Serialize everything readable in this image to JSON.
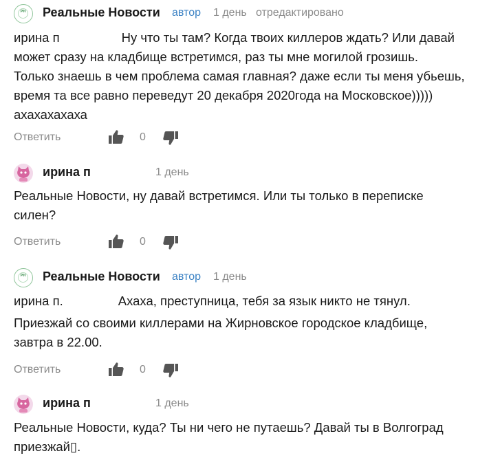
{
  "comments": [
    {
      "author": "Реальные Новости",
      "badge": "автор",
      "time": "1 день",
      "edited": "отредактировано",
      "avatar": "rn-logo-icon",
      "avatar_text": "РН",
      "text_prefix": "ирина п",
      "lines": [
        "Ну что ты там? Когда твоих киллеров ждать? Или давай",
        "может сразу на кладбище встретимся, раз ты мне могилой грозишь.",
        "Только знаешь в чем проблема самая главная? даже если ты меня убьешь,",
        "время та все равно переведут 20 декабря 2020года на Московское)))))",
        "ахахахахаха"
      ],
      "reply_label": "Ответить",
      "likes": "0"
    },
    {
      "author": "ирина п",
      "time": "1 день",
      "avatar": "pink-cat-avatar-icon",
      "lines": [
        "Реальные Новости, ну давай встретимся. Или ты только в переписке",
        "силен?"
      ],
      "reply_label": "Ответить",
      "likes": "0"
    },
    {
      "author": "Реальные Новости",
      "badge": "автор",
      "time": "1 день",
      "avatar": "rn-logo-icon",
      "avatar_text": "РН",
      "text_prefix": "ирина п.",
      "lines": [
        "Ахаха, преступница, тебя за язык никто не тянул.",
        "Приезжай со своими киллерами на Жирновское городское кладбище,",
        "завтра в 22.00."
      ],
      "reply_label": "Ответить",
      "likes": "0"
    },
    {
      "author": "ирина п",
      "time": "1 день",
      "avatar": "pink-cat-avatar-icon",
      "lines": [
        "Реальные Новости, куда? Ты ни чего не путаешь? Давай ты в Волгоград",
        "приезжай▯."
      ]
    }
  ],
  "colors": {
    "badge": "#3b82c4",
    "muted": "#8a8a8a",
    "text": "#1a1a1a",
    "avatar_pink": "#f3d9ea",
    "logo_green": "#4e9a5f"
  }
}
